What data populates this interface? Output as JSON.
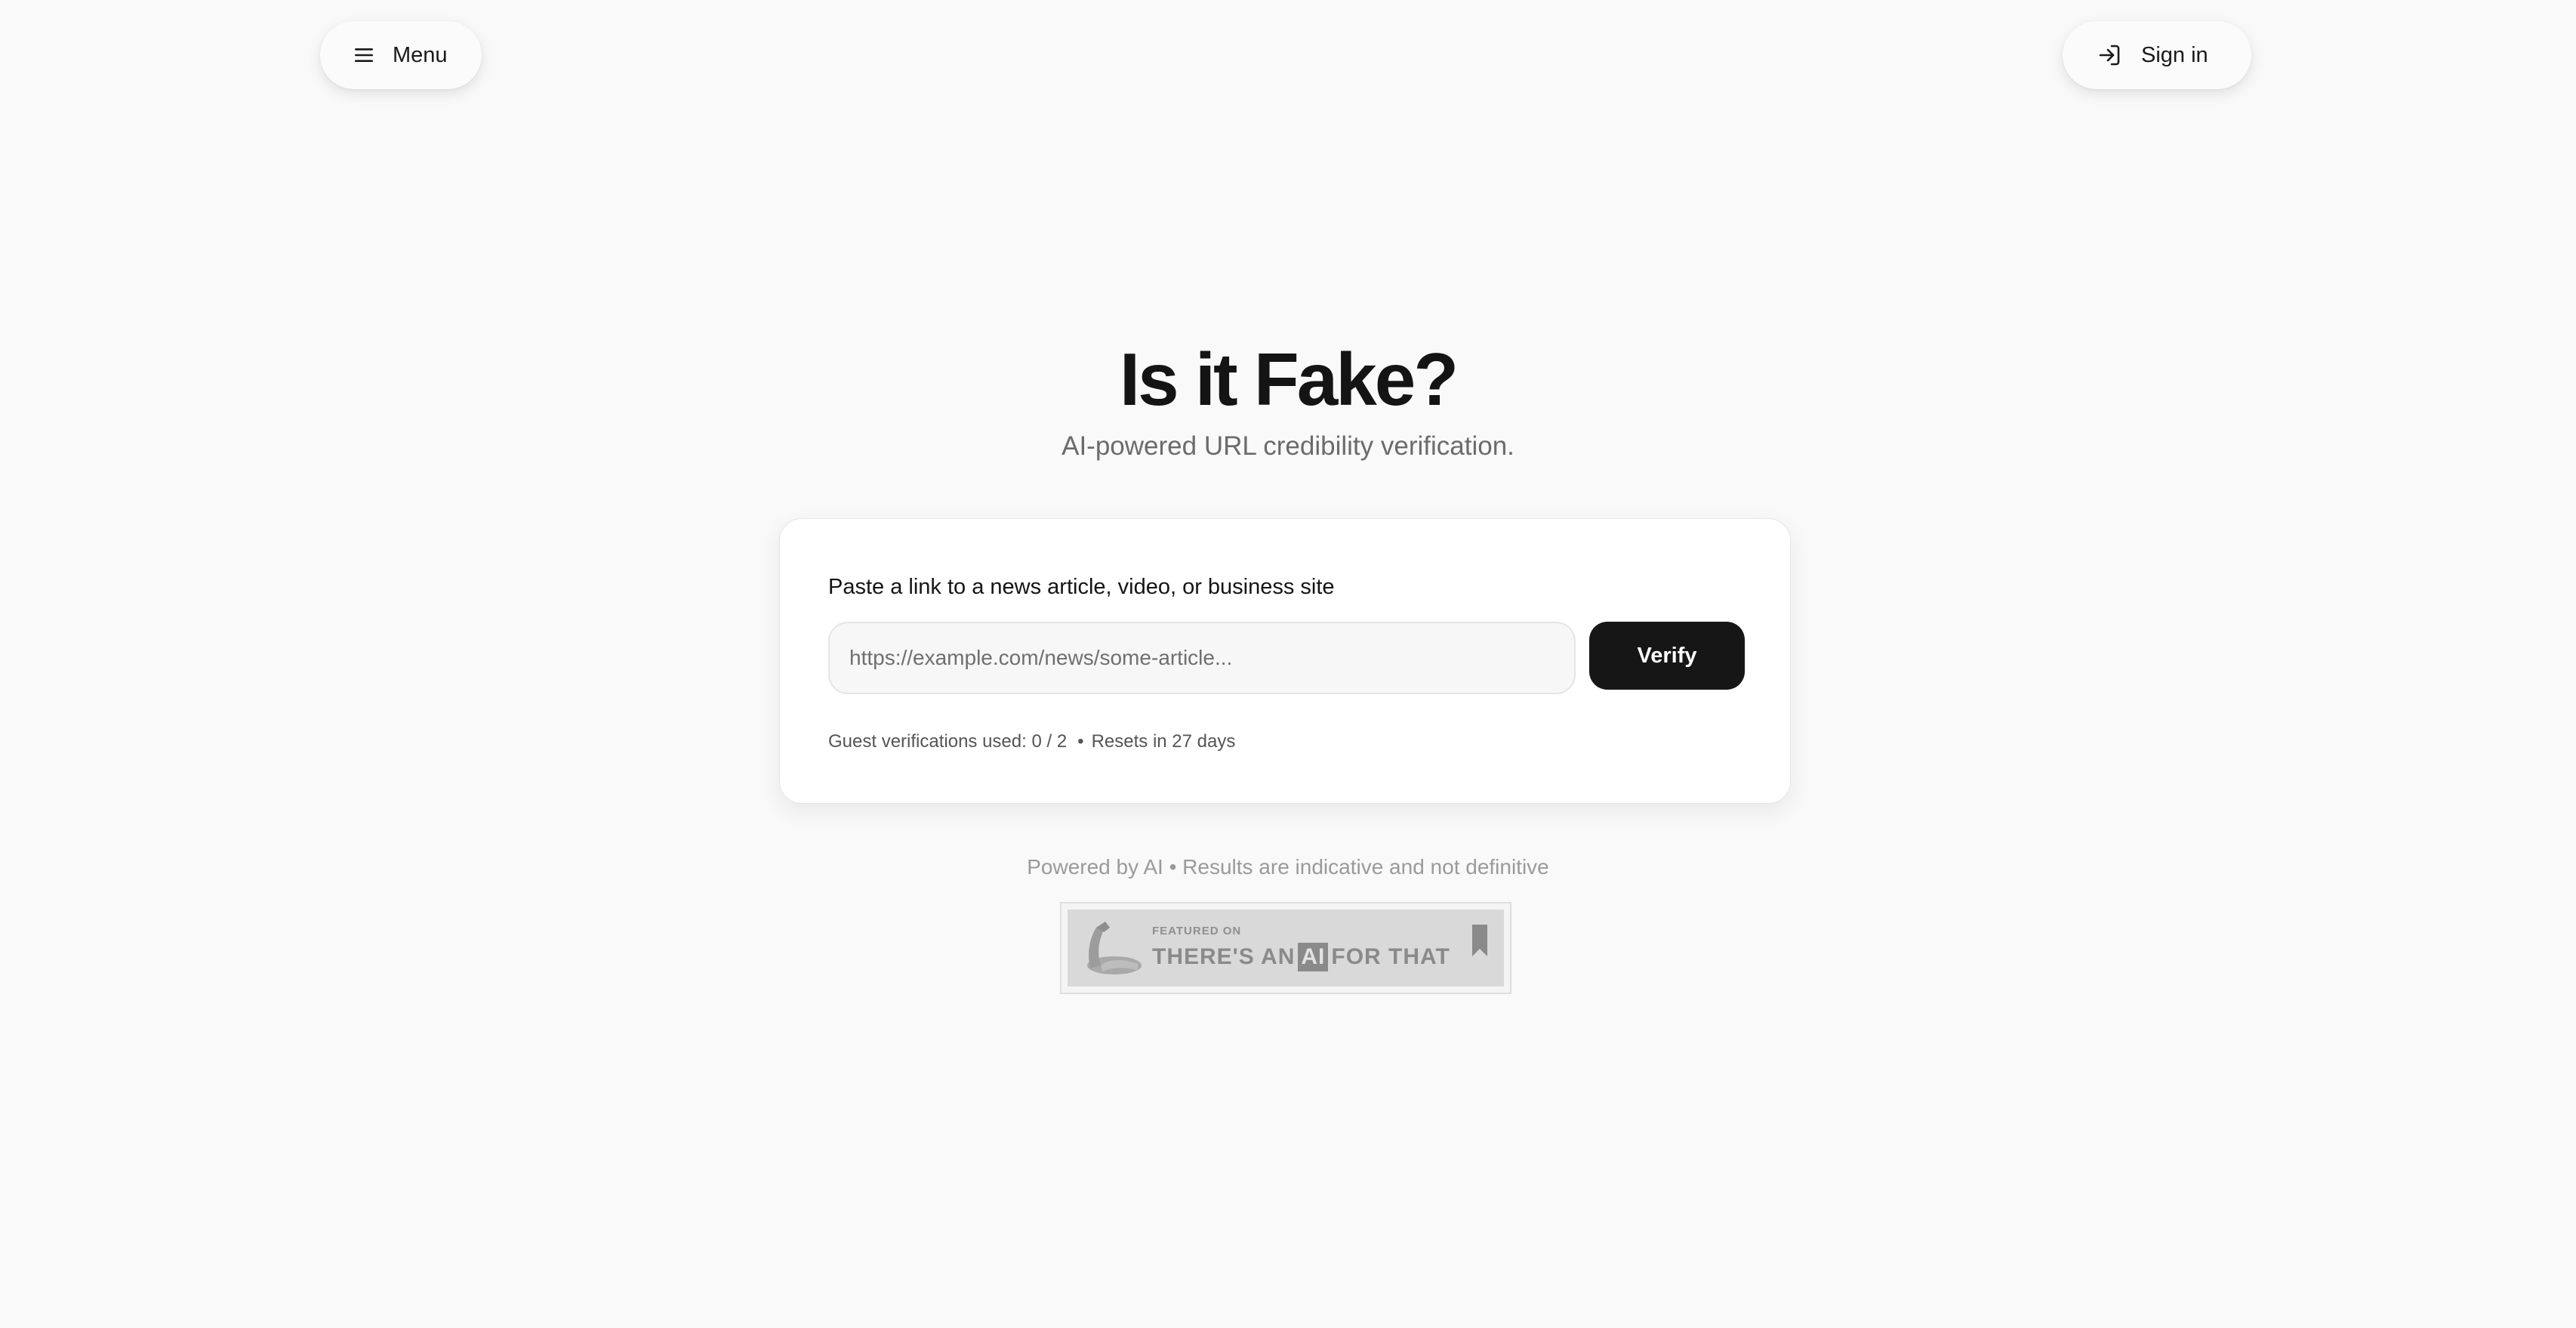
{
  "header": {
    "menu_label": "Menu",
    "signin_label": "Sign in"
  },
  "hero": {
    "title": "Is it Fake?",
    "subtitle": "AI-powered URL credibility verification."
  },
  "verify_card": {
    "label": "Paste a link to a news article, video, or business site",
    "input_placeholder": "https://example.com/news/some-article...",
    "input_value": "",
    "verify_label": "Verify",
    "usage_text": "Guest verifications used: 0 / 2",
    "separator": "•",
    "reset_text": "Resets in 27 days"
  },
  "footer": {
    "note": "Powered by AI • Results are indicative and not definitive",
    "badge": {
      "featured_text": "FEATURED ON",
      "brand_pre": "THERE'S AN",
      "brand_ai": "AI",
      "brand_post": "FOR THAT"
    }
  },
  "icons": {
    "menu": "hamburger-icon",
    "signin": "sign-in-icon"
  },
  "colors": {
    "background": "#f9f9f9",
    "primary_button": "#161616",
    "card": "#ffffff",
    "muted_text": "#9a9a9a"
  }
}
